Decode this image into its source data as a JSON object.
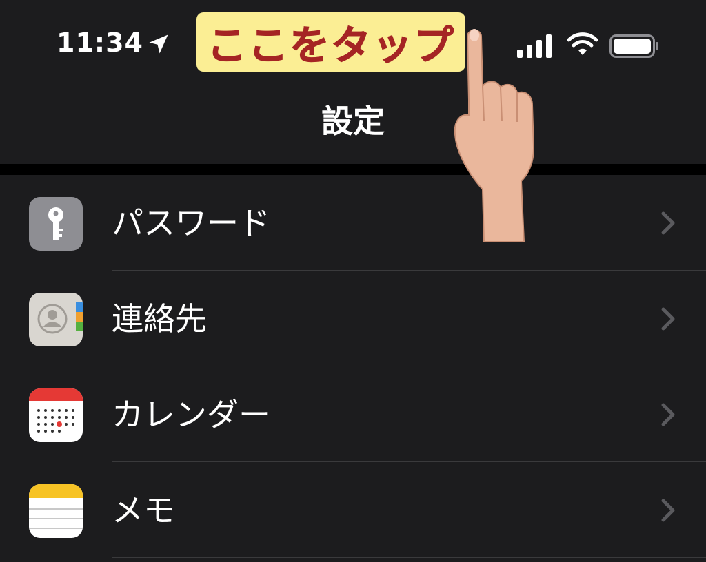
{
  "status_bar": {
    "time": "11:34"
  },
  "banner": {
    "text": "ここをタップ"
  },
  "nav": {
    "title": "設定"
  },
  "items": [
    {
      "label": "パスワード",
      "icon": "key-icon"
    },
    {
      "label": "連絡先",
      "icon": "contacts-icon"
    },
    {
      "label": "カレンダー",
      "icon": "calendar-icon"
    },
    {
      "label": "メモ",
      "icon": "notes-icon"
    }
  ]
}
